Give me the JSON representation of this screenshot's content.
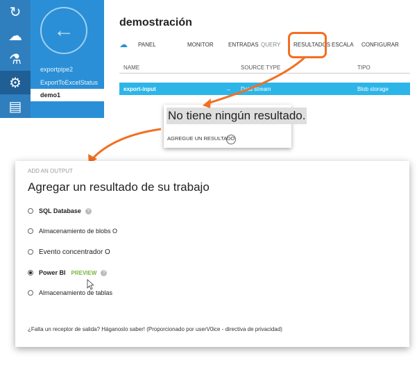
{
  "rail": {
    "icons": [
      "stream-icon",
      "cloud-sync-icon",
      "flask-icon",
      "gear-icon",
      "chart-icon"
    ]
  },
  "sidebar": {
    "items": [
      {
        "label": "exportpipe2"
      },
      {
        "label": "ExportToExcelStatus"
      },
      {
        "label": "demo1",
        "selected": true
      }
    ]
  },
  "header": {
    "title": "demostración",
    "tabs": [
      {
        "label": "PANEL"
      },
      {
        "label": "MONITOR"
      },
      {
        "label": "ENTRADAS"
      },
      {
        "label": "QUERY"
      },
      {
        "label": "RESULTADOS"
      },
      {
        "label": "ESCALA"
      },
      {
        "label": "CONFIGURAR"
      }
    ]
  },
  "table": {
    "columns": [
      "NAME",
      "SOURCE TYPE",
      "TIPO"
    ],
    "rows": [
      {
        "name": "export-input",
        "source": "Data stream",
        "type": "Blob storage"
      }
    ]
  },
  "popup": {
    "message": "No tiene ningún resultado.",
    "action": "AGREGUE UN RESULTADO"
  },
  "dialog": {
    "kicker": "ADD AN OUTPUT",
    "heading": "Agregar un resultado de su trabajo",
    "options": [
      {
        "label": "SQL Database",
        "help": "?"
      },
      {
        "label": "Almacenamiento de blobs O"
      },
      {
        "label": "Evento concentrador O"
      },
      {
        "label": "Power BI",
        "badge": "PREVIEW",
        "help": "?",
        "selected": true
      },
      {
        "label": "Almacenamiento de tablas"
      }
    ],
    "footer": "¿Falta un receptor de salida? Háganoslo saber! (Proporcionado por userV0ice - directiva de privacidad)"
  },
  "colors": {
    "accent": "#2a8fd6",
    "highlight": "#f26f21",
    "row": "#2eb5e8",
    "preview": "#7ab33e"
  }
}
